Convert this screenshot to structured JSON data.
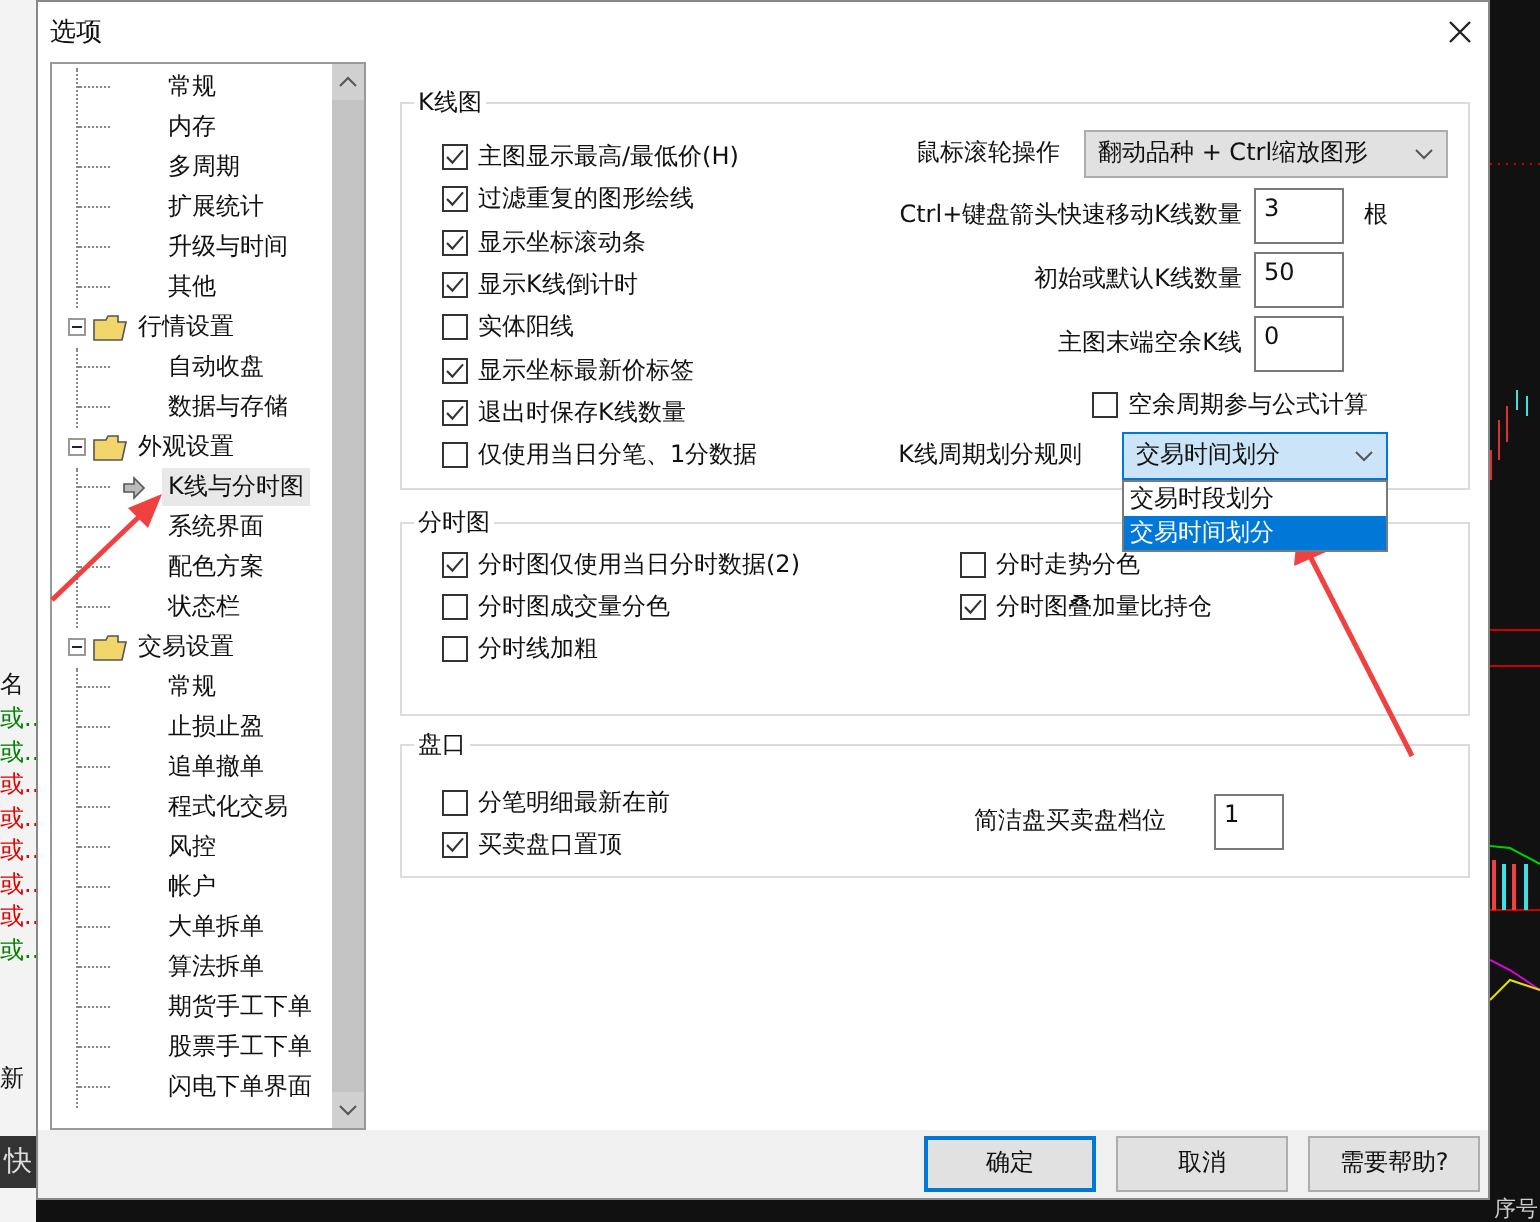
{
  "background": {
    "left_header": "名",
    "left_rows": [
      {
        "text": "或..",
        "color": "#008000"
      },
      {
        "text": "或..",
        "color": "#008000"
      },
      {
        "text": "或..",
        "color": "#e00000"
      },
      {
        "text": "或..",
        "color": "#e00000"
      },
      {
        "text": "或..",
        "color": "#e00000"
      },
      {
        "text": "或..",
        "color": "#e00000"
      },
      {
        "text": "或..",
        "color": "#e00000"
      },
      {
        "text": "或..",
        "color": "#008000"
      }
    ],
    "left_footer": "新",
    "left_button": "快",
    "bottom_header": "序号"
  },
  "dialog": {
    "title": "选项"
  },
  "tree": [
    {
      "children": [
        {
          "label": "常规",
          "selected": false
        },
        {
          "label": "内存",
          "selected": false
        },
        {
          "label": "多周期",
          "selected": false
        },
        {
          "label": "扩展统计",
          "selected": false
        },
        {
          "label": "升级与时间",
          "selected": false
        },
        {
          "label": "其他",
          "selected": false
        }
      ]
    },
    {
      "label": "行情设置",
      "expanded": true,
      "children": [
        {
          "label": "自动收盘",
          "selected": false
        },
        {
          "label": "数据与存储",
          "selected": false
        }
      ]
    },
    {
      "label": "外观设置",
      "expanded": true,
      "children": [
        {
          "label": "K线与分时图",
          "selected": true
        },
        {
          "label": "系统界面",
          "selected": false
        },
        {
          "label": "配色方案",
          "selected": false
        },
        {
          "label": "状态栏",
          "selected": false
        }
      ]
    },
    {
      "label": "交易设置",
      "expanded": true,
      "children": [
        {
          "label": "常规",
          "selected": false
        },
        {
          "label": "止损止盈",
          "selected": false
        },
        {
          "label": "追单撤单",
          "selected": false
        },
        {
          "label": "程式化交易",
          "selected": false
        },
        {
          "label": "风控",
          "selected": false
        },
        {
          "label": "帐户",
          "selected": false
        },
        {
          "label": "大单拆单",
          "selected": false
        },
        {
          "label": "算法拆单",
          "selected": false
        },
        {
          "label": "期货手工下单",
          "selected": false
        },
        {
          "label": "股票手工下单",
          "selected": false
        },
        {
          "label": "闪电下单界面",
          "selected": false
        }
      ]
    }
  ],
  "kline": {
    "title": "K线图",
    "checks": [
      {
        "label": "主图显示最高/最低价(H)",
        "checked": true
      },
      {
        "label": "过滤重复的图形绘线",
        "checked": true
      },
      {
        "label": "显示坐标滚动条",
        "checked": true
      },
      {
        "label": "显示K线倒计时",
        "checked": true
      },
      {
        "label": "实体阳线",
        "checked": false
      },
      {
        "label": "显示坐标最新价标签",
        "checked": true
      },
      {
        "label": "退出时保存K线数量",
        "checked": true
      },
      {
        "label": "仅使用当日分笔、1分数据",
        "checked": false
      }
    ],
    "wheel": {
      "label": "鼠标滚轮操作",
      "value": "翻动品种 + Ctrl缩放图形"
    },
    "fields": [
      {
        "label": "Ctrl+键盘箭头快速移动K线数量",
        "value": "3",
        "unit": "根"
      },
      {
        "label": "初始或默认K线数量",
        "value": "50"
      },
      {
        "label": "主图末端空余K线",
        "value": "0"
      }
    ],
    "extra_check": {
      "label": "空余周期参与公式计算",
      "checked": false
    },
    "period": {
      "label": "K线周期划分规则",
      "value": "交易时间划分",
      "expanded": true,
      "options": [
        {
          "label": "交易时段划分",
          "selected": false
        },
        {
          "label": "交易时间划分",
          "selected": true
        }
      ]
    }
  },
  "timeshare": {
    "title": "分时图",
    "left": [
      {
        "label": "分时图仅使用当日分时数据(2)",
        "checked": true
      },
      {
        "label": "分时图成交量分色",
        "checked": false
      },
      {
        "label": "分时线加粗",
        "checked": false
      }
    ],
    "right": [
      {
        "label": "分时走势分色",
        "checked": false
      },
      {
        "label": "分时图叠加量比持仓",
        "checked": true
      }
    ]
  },
  "depth": {
    "title": "盘口",
    "checks": [
      {
        "label": "分笔明细最新在前",
        "checked": false
      },
      {
        "label": "买卖盘口置顶",
        "checked": true
      }
    ],
    "field": {
      "label": "简洁盘买卖盘档位",
      "value": "1"
    }
  },
  "buttons": [
    {
      "label": "确定",
      "default": true
    },
    {
      "label": "取消",
      "default": false
    },
    {
      "label": "需要帮助?",
      "default": false
    }
  ]
}
